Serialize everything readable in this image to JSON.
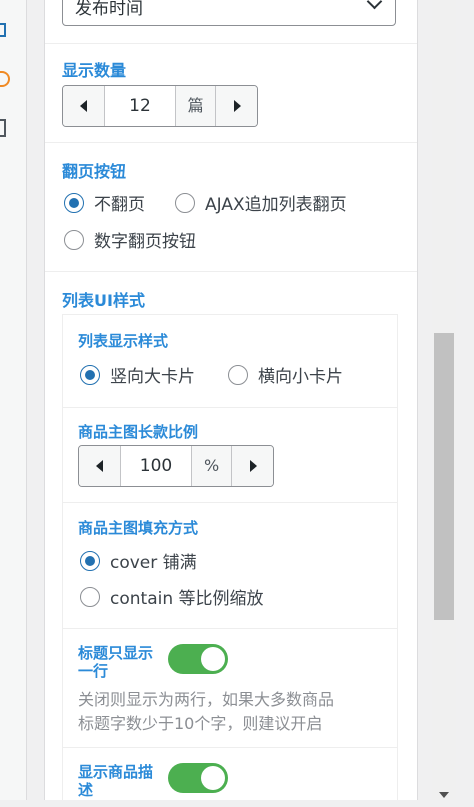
{
  "sort_select": {
    "value": "发布时间"
  },
  "count_section": {
    "title": "显示数量",
    "value": "12",
    "unit": "篇"
  },
  "pagination_section": {
    "title": "翻页按钮",
    "options": [
      {
        "label": "不翻页",
        "checked": true
      },
      {
        "label": "AJAX追加列表翻页",
        "checked": false
      },
      {
        "label": "数字翻页按钮",
        "checked": false
      }
    ]
  },
  "list_ui_section": {
    "title": "列表UI样式",
    "list_style": {
      "title": "列表显示样式",
      "options": [
        {
          "label": "竖向大卡片",
          "checked": true
        },
        {
          "label": "横向小卡片",
          "checked": false
        }
      ]
    },
    "image_ratio": {
      "title": "商品主图长款比例",
      "value": "100",
      "unit": "%"
    },
    "image_fill": {
      "title": "商品主图填充方式",
      "options": [
        {
          "label": "cover 铺满",
          "checked": true
        },
        {
          "label": "contain 等比例缩放",
          "checked": false
        }
      ]
    },
    "title_single_line": {
      "label_line1": "标题只显示",
      "label_line2": "一行",
      "enabled": true,
      "help_line1": "关闭则显示为两行，如果大多数商品",
      "help_line2": "标题字数少于10个字，则建议开启"
    },
    "show_description": {
      "label_line1": "显示商品描",
      "label_line2": "述",
      "enabled": true
    }
  },
  "colors": {
    "accent": "#2b8ad8",
    "radio": "#2271b1",
    "toggle_on": "#4caf50"
  }
}
